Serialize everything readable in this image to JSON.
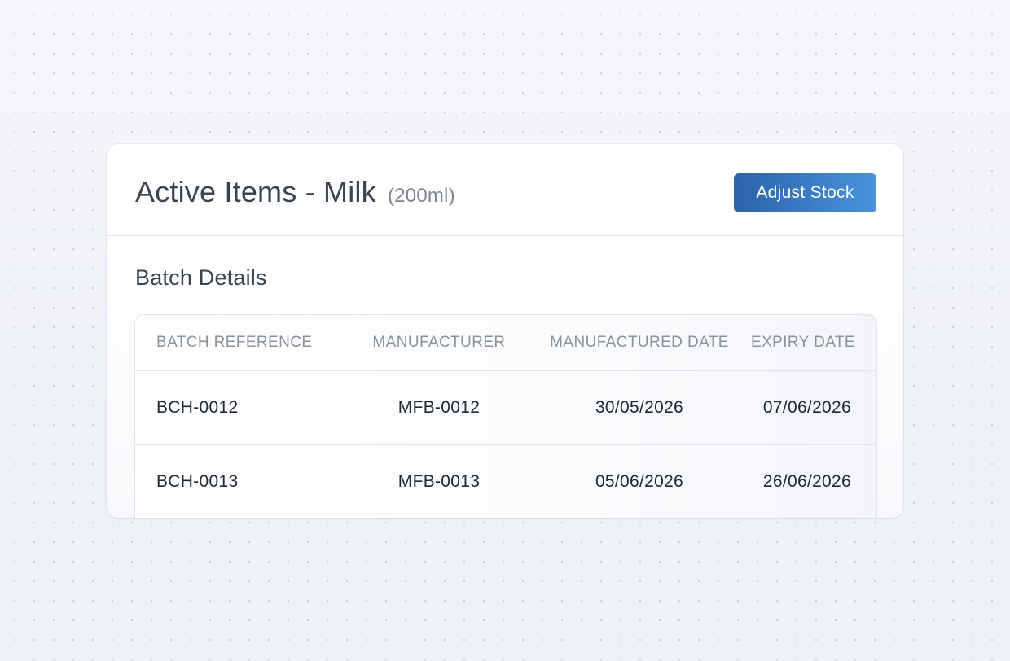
{
  "header": {
    "title": "Active Items - Milk",
    "subtitle": "(200ml)",
    "adjust_button_label": "Adjust Stock"
  },
  "section": {
    "title": "Batch Details"
  },
  "table": {
    "columns": [
      "BATCH REFERENCE",
      "MANUFACTURER",
      "MANUFACTURED DATE",
      "EXPIRY DATE"
    ],
    "rows": [
      [
        "BCH-0012",
        "MFB-0012",
        "30/05/2026",
        "07/06/2026"
      ],
      [
        "BCH-0013",
        "MFB-0013",
        "05/06/2026",
        "26/06/2026"
      ]
    ]
  },
  "colors": {
    "button_gradient_start": "#2b63a8",
    "button_gradient_end": "#4893dc",
    "title_text": "#3b4552",
    "header_text": "#8a929d",
    "cell_text": "#202938"
  }
}
